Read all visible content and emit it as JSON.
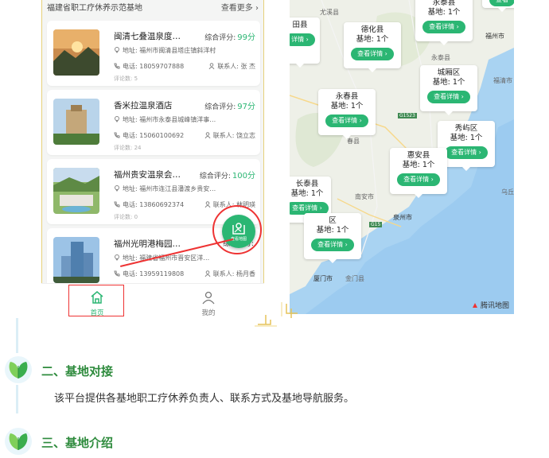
{
  "list_header": {
    "title": "福建省职工疗休养示范基地",
    "more": "查看更多"
  },
  "cards": [
    {
      "title": "闽清七叠温泉度…",
      "score_label": "综合评分:",
      "score": "99分",
      "address": "地址: 福州市闽清县塔庄镇斜洋村",
      "phone": "电话: 18059707888",
      "contact": "联系人: 张 杰",
      "reviews": "评论数: 5"
    },
    {
      "title": "香米拉温泉酒店",
      "score_label": "综合评分:",
      "score": "97分",
      "address": "地址: 福州市永泰县城峰镇洋事…",
      "phone": "电话: 15060100692",
      "contact": "联系人: 饶立志",
      "reviews": "评论数: 24"
    },
    {
      "title": "福州贵安温泉会…",
      "score_label": "综合评分:",
      "score": "100分",
      "address": "地址: 福州市连江县潘渡乡贵安…",
      "phone": "电话: 13860692374",
      "contact": "联系人: 林明瑛",
      "reviews": "评论数: 0"
    },
    {
      "title": "福州光明港梅园…",
      "score_label": "综合评分:",
      "score": "",
      "address": "地址: 福建省福州市晋安区洋…",
      "phone": "电话: 13959119808",
      "contact": "联系人: 杨月香",
      "reviews": "评论数: 0"
    }
  ],
  "float_button": {
    "label": "查看地图"
  },
  "tabbar": {
    "home": "首页",
    "mine": "我的"
  },
  "map": {
    "place_labels": [
      "尤溪县",
      "永泰县",
      "福州市",
      "福清市",
      "南安市",
      "泉州市",
      "厦门市",
      "金门县",
      "乌丘",
      "G1523",
      "G15",
      "春县",
      "田县"
    ],
    "callouts": [
      {
        "name": "德化县",
        "count": "基地: 1个",
        "button": "查看详情"
      },
      {
        "name": "永泰县",
        "count": "基地: 1个",
        "button": "查看详情"
      },
      {
        "name": "城厢区",
        "count": "基地: 1个",
        "button": "查看详情"
      },
      {
        "name": "永春县",
        "count": "基地: 1个",
        "button": "查看详情"
      },
      {
        "name": "秀屿区",
        "count": "基地: 1个",
        "button": "查看详情"
      },
      {
        "name": "惠安县",
        "count": "基地: 1个",
        "button": "查看详情"
      },
      {
        "name": "长泰县",
        "count": "基地: 1个",
        "button": "查看详情"
      },
      {
        "name": "区",
        "count": "基地: 1个",
        "button": "查看详情"
      },
      {
        "name": "田县",
        "count": "",
        "button": "详情"
      },
      {
        "name": "",
        "count": "",
        "button": "查看"
      }
    ],
    "brand": "腾讯地图"
  },
  "sections": [
    {
      "heading": "二、基地对接",
      "text": "该平台提供各基地职工疗休养负责人、联系方式及基地导航服务。"
    },
    {
      "heading": "三、基地介绍"
    }
  ],
  "colors": {
    "accent_green": "#2bb673",
    "heading_green": "#2e8b3d",
    "annotation_red": "#e33333"
  }
}
